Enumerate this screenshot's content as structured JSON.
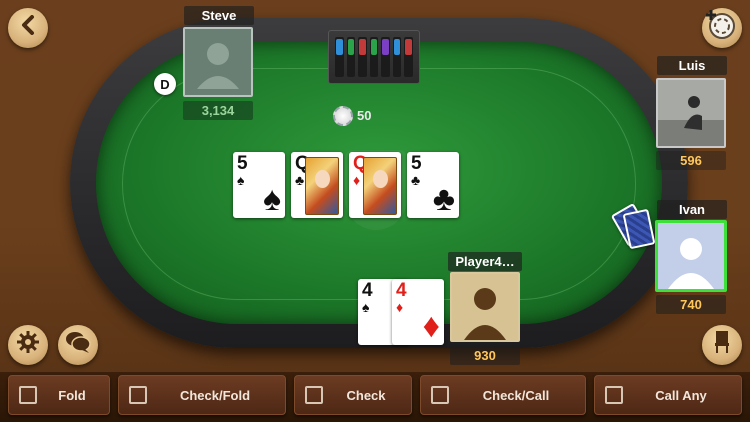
{
  "players": {
    "steve": {
      "name": "Steve",
      "chips": "3,134"
    },
    "luis": {
      "name": "Luis",
      "chips": "596"
    },
    "ivan": {
      "name": "Ivan",
      "chips": "740"
    },
    "hero": {
      "name": "Player4…",
      "chips": "930"
    }
  },
  "dealer_button": "D",
  "pot": {
    "value": "50"
  },
  "board": [
    {
      "rank": "5",
      "suit": "♠",
      "color": "black",
      "face": false
    },
    {
      "rank": "Q",
      "suit": "♣",
      "color": "black",
      "face": true
    },
    {
      "rank": "Q",
      "suit": "♦",
      "color": "red",
      "face": true
    },
    {
      "rank": "5",
      "suit": "♣",
      "color": "black",
      "face": false
    }
  ],
  "hero_hand": [
    {
      "rank": "4",
      "suit": "♠",
      "color": "black"
    },
    {
      "rank": "4",
      "suit": "♦",
      "color": "red"
    }
  ],
  "icons": {
    "back": "chevron-left-icon",
    "add_chips": "chip-plus-icon",
    "settings": "gear-icon",
    "chat": "chat-bubbles-icon",
    "stand_up": "chair-icon"
  },
  "actions": [
    {
      "label": "Fold"
    },
    {
      "label": "Check/Fold"
    },
    {
      "label": "Check"
    },
    {
      "label": "Check/Call"
    },
    {
      "label": "Call Any"
    }
  ],
  "colors": {
    "felt": "#1d7a2a",
    "chips_text": "#ffc75a",
    "active_player_border": "#3fe03a"
  }
}
